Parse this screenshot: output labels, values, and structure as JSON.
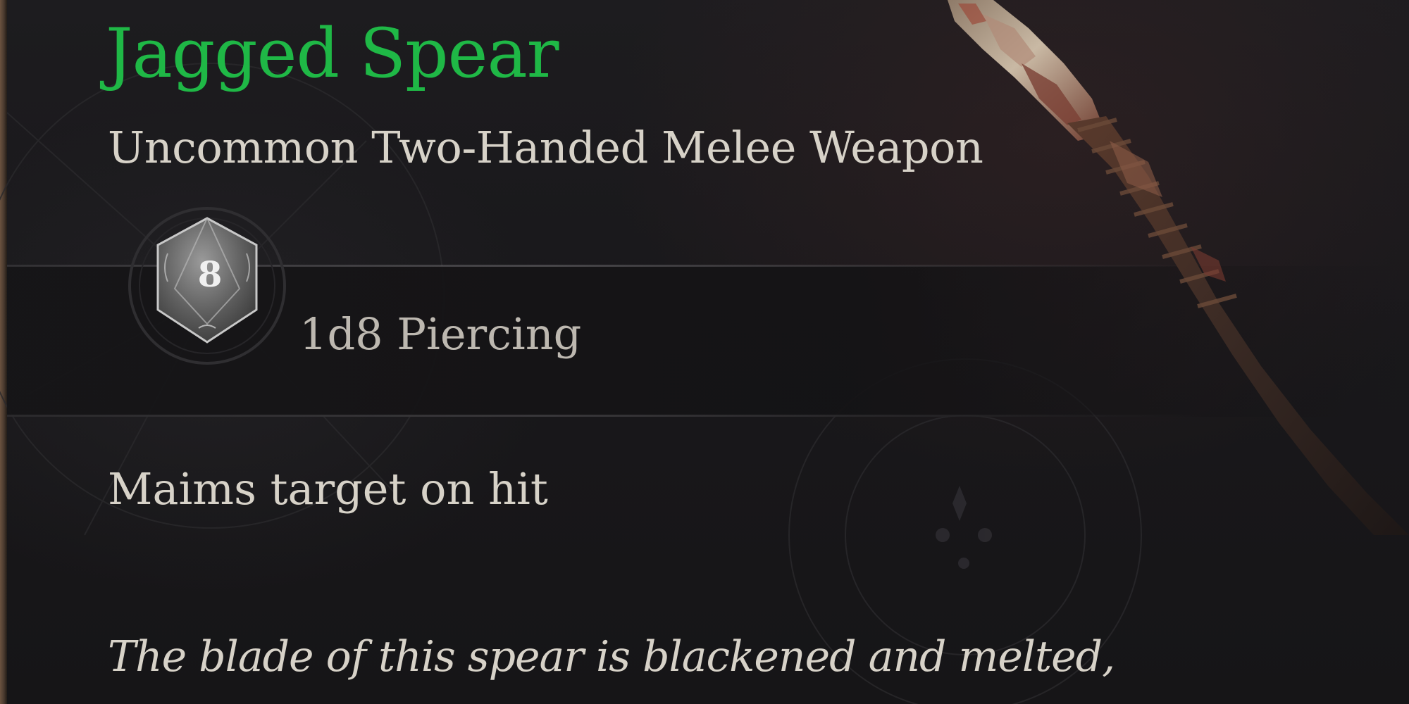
{
  "tooltip": {
    "item_name": "Jagged Spear",
    "item_type": "Uncommon Two-Handed Melee Weapon",
    "damage": {
      "die_face": "8",
      "text": "1d8 Piercing"
    },
    "passive": "Maims target on hit",
    "flavor": "The blade of this spear is blackened and melted,"
  },
  "colors": {
    "rarity_uncommon": "#1fb846",
    "body_text": "#d7d2c8",
    "damage_text": "#bdb8b0",
    "background": "#19181b"
  },
  "icons": {
    "damage_die": "d8-dice-icon",
    "item_image": "spear-item-image"
  }
}
